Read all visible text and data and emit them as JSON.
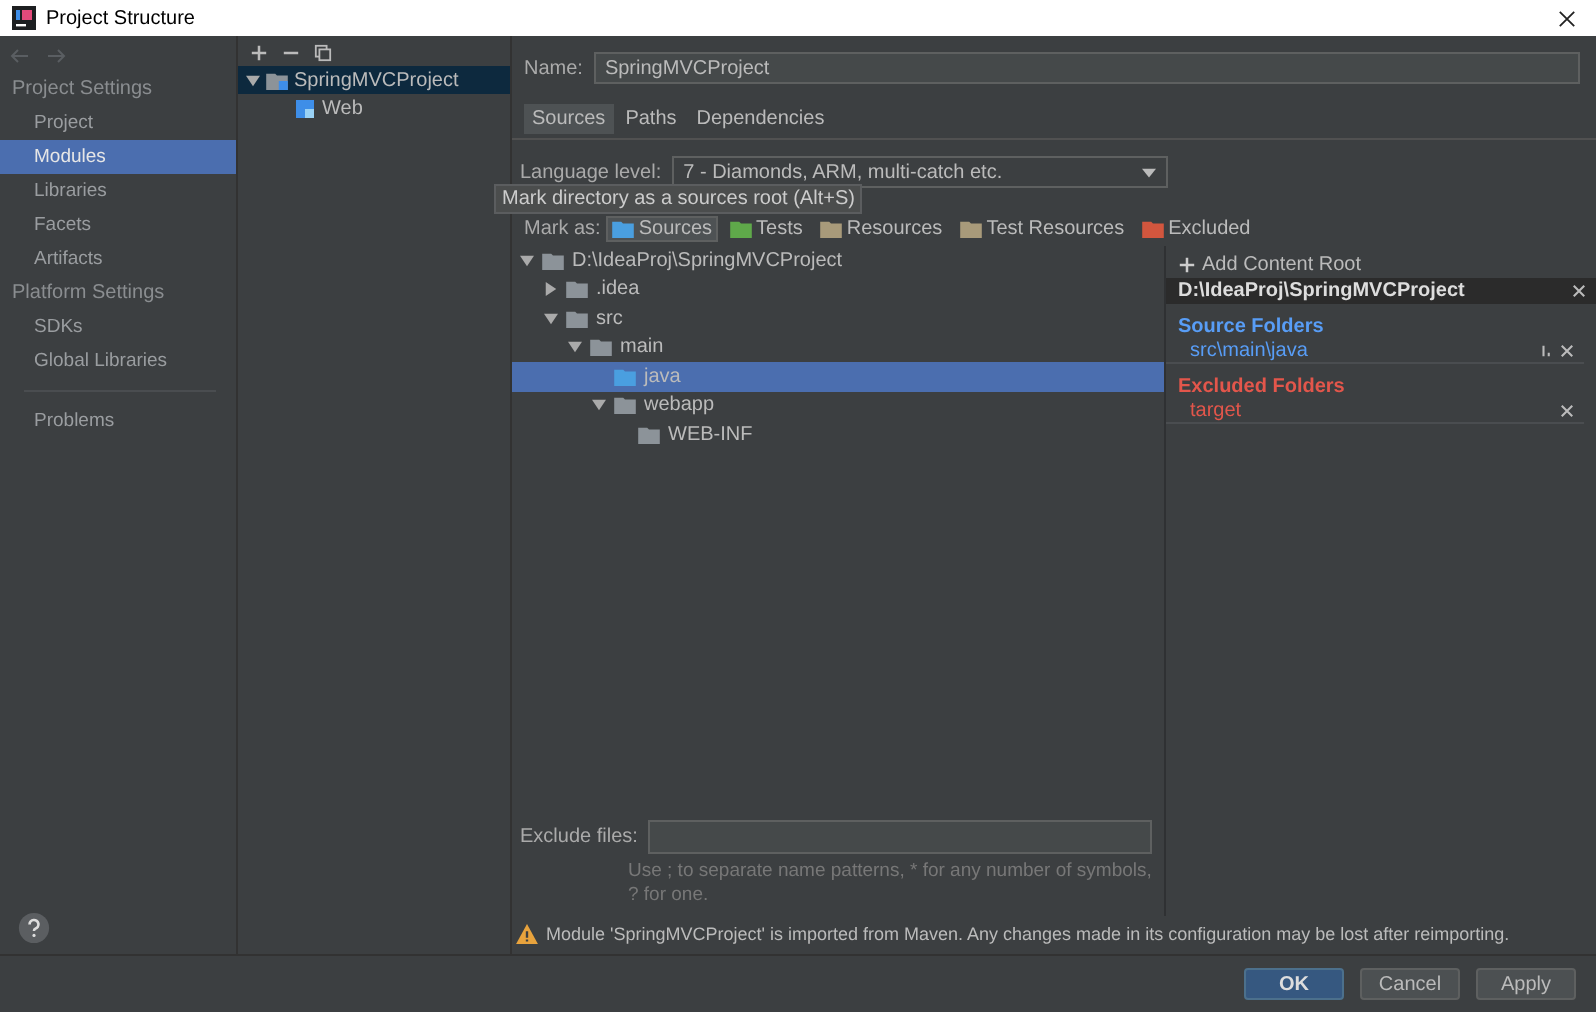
{
  "window": {
    "title": "Project Structure"
  },
  "sidebar": {
    "sections": [
      {
        "heading": "Project Settings",
        "items": [
          {
            "label": "Project",
            "selected": false
          },
          {
            "label": "Modules",
            "selected": true
          },
          {
            "label": "Libraries",
            "selected": false
          },
          {
            "label": "Facets",
            "selected": false
          },
          {
            "label": "Artifacts",
            "selected": false
          }
        ]
      },
      {
        "heading": "Platform Settings",
        "items": [
          {
            "label": "SDKs",
            "selected": false
          },
          {
            "label": "Global Libraries",
            "selected": false
          }
        ]
      }
    ],
    "bottom_items": [
      {
        "label": "Problems",
        "selected": false
      }
    ]
  },
  "module_tree": [
    {
      "label": "SpringMVCProject",
      "selected": true,
      "expanded": true,
      "children": [
        {
          "label": "Web",
          "selected": false
        }
      ]
    }
  ],
  "name_field": {
    "label": "Name:",
    "value": "SpringMVCProject"
  },
  "tabs": [
    {
      "label": "Sources",
      "selected": true
    },
    {
      "label": "Paths",
      "selected": false
    },
    {
      "label": "Dependencies",
      "selected": false
    }
  ],
  "language_level": {
    "label": "Language level:",
    "value": "7 - Diamonds, ARM, multi-catch etc."
  },
  "tooltip": "Mark directory as a sources root (Alt+S)",
  "mark_as": {
    "label": "Mark as:",
    "buttons": [
      {
        "label": "Sources",
        "kind": "source",
        "selected": true
      },
      {
        "label": "Tests",
        "kind": "test",
        "selected": false
      },
      {
        "label": "Resources",
        "kind": "resource",
        "selected": false
      },
      {
        "label": "Test Resources",
        "kind": "test-resource",
        "selected": false
      },
      {
        "label": "Excluded",
        "kind": "excluded",
        "selected": false
      }
    ]
  },
  "folder_tree": [
    {
      "label": "D:\\IdeaProj\\SpringMVCProject",
      "kind": "folder",
      "selected": false,
      "expanded": true,
      "children": [
        {
          "label": ".idea",
          "kind": "folder",
          "selected": false,
          "expanded": false
        },
        {
          "label": "src",
          "kind": "folder",
          "selected": false,
          "expanded": true,
          "children": [
            {
              "label": "main",
              "kind": "folder",
              "selected": false,
              "expanded": true,
              "children": [
                {
                  "label": "java",
                  "kind": "source",
                  "selected": true
                },
                {
                  "label": "webapp",
                  "kind": "folder",
                  "selected": false,
                  "expanded": true,
                  "children": [
                    {
                      "label": "WEB-INF",
                      "kind": "folder",
                      "selected": false
                    }
                  ]
                }
              ]
            }
          ]
        }
      ]
    }
  ],
  "content_root": {
    "add_label": "Add Content Root",
    "path": "D:\\IdeaProj\\SpringMVCProject",
    "groups": [
      {
        "heading": "Source Folders",
        "kind": "source",
        "items": [
          "src\\main\\java"
        ]
      },
      {
        "heading": "Excluded Folders",
        "kind": "excluded",
        "items": [
          "target"
        ]
      }
    ]
  },
  "exclude_files": {
    "label": "Exclude files:",
    "hint": "Use ; to separate name patterns, * for any number of symbols, ? for one."
  },
  "warning": "Module 'SpringMVCProject' is imported from Maven. Any changes made in its configuration may be lost after reimporting.",
  "buttons": [
    {
      "label": "OK",
      "selected": true
    },
    {
      "label": "Cancel",
      "selected": false
    },
    {
      "label": "Apply",
      "selected": false
    }
  ]
}
